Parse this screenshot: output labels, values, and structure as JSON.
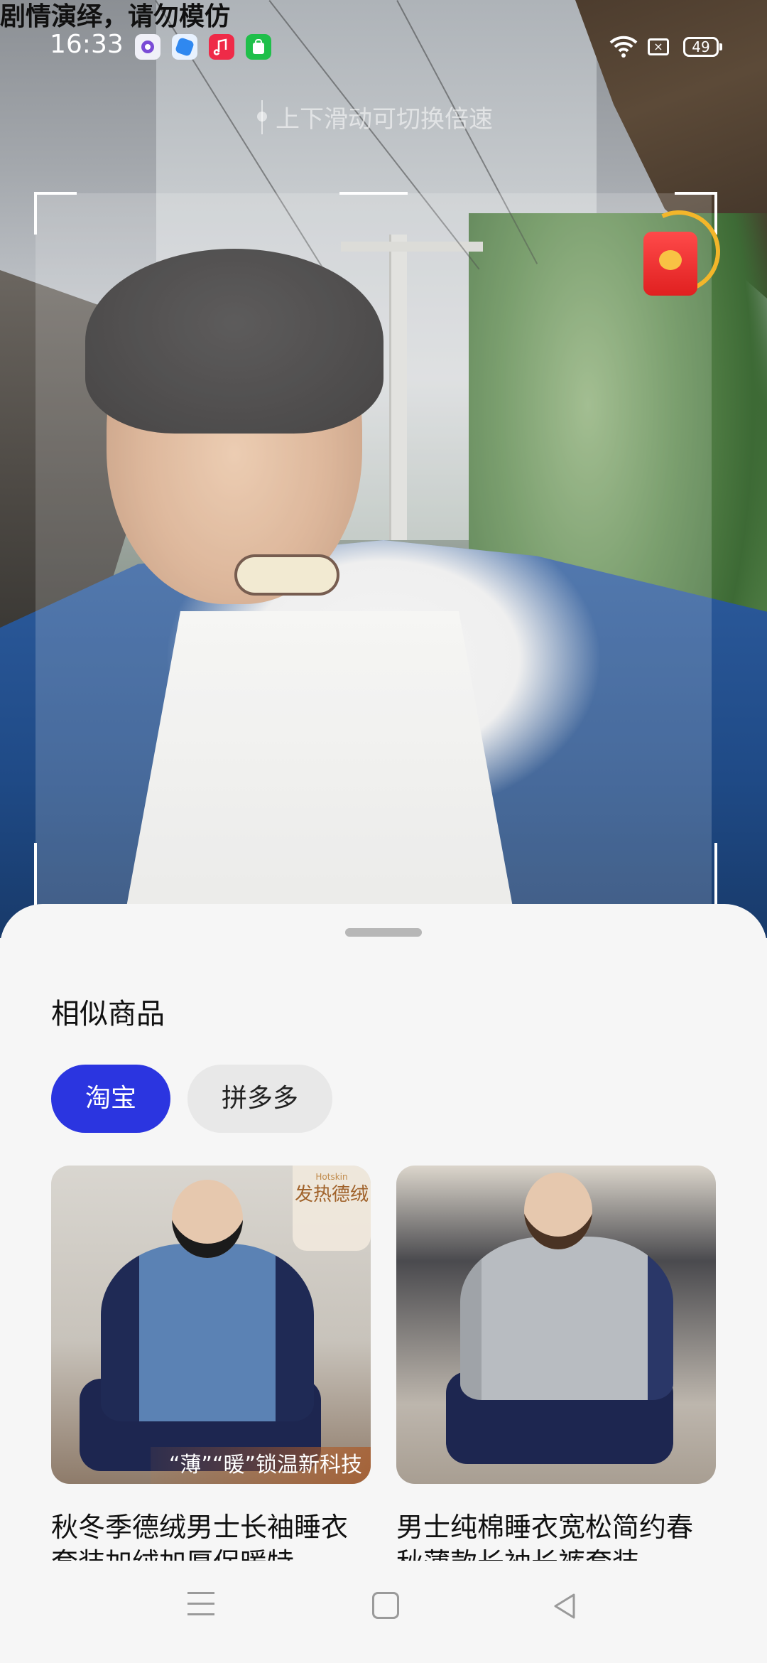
{
  "overlay": {
    "watermark": "剧情演绎，请勿模仿",
    "hint": "上下滑动可切换倍速"
  },
  "status_bar": {
    "time": "16:33",
    "battery": "49",
    "app_icons": [
      "camera-app-icon",
      "browser-app-icon",
      "music-app-icon",
      "store-app-icon"
    ]
  },
  "sheet": {
    "title": "相似商品",
    "tabs": [
      {
        "label": "淘宝",
        "active": true
      },
      {
        "label": "拼多多",
        "active": false
      }
    ],
    "products": [
      {
        "title": "秋冬季德绒男士长袖睡衣套装加绒加厚保暖特",
        "badge_brand": "Hotskin",
        "badge_text": "发热德绒",
        "banner": "“薄”“暖”锁温新科技"
      },
      {
        "title": "男士纯棉睡衣宽松简约春秋薄款长袖长裤套装"
      }
    ]
  },
  "colors": {
    "accent": "#2b35e0",
    "sheet_bg": "#f6f6f6"
  }
}
